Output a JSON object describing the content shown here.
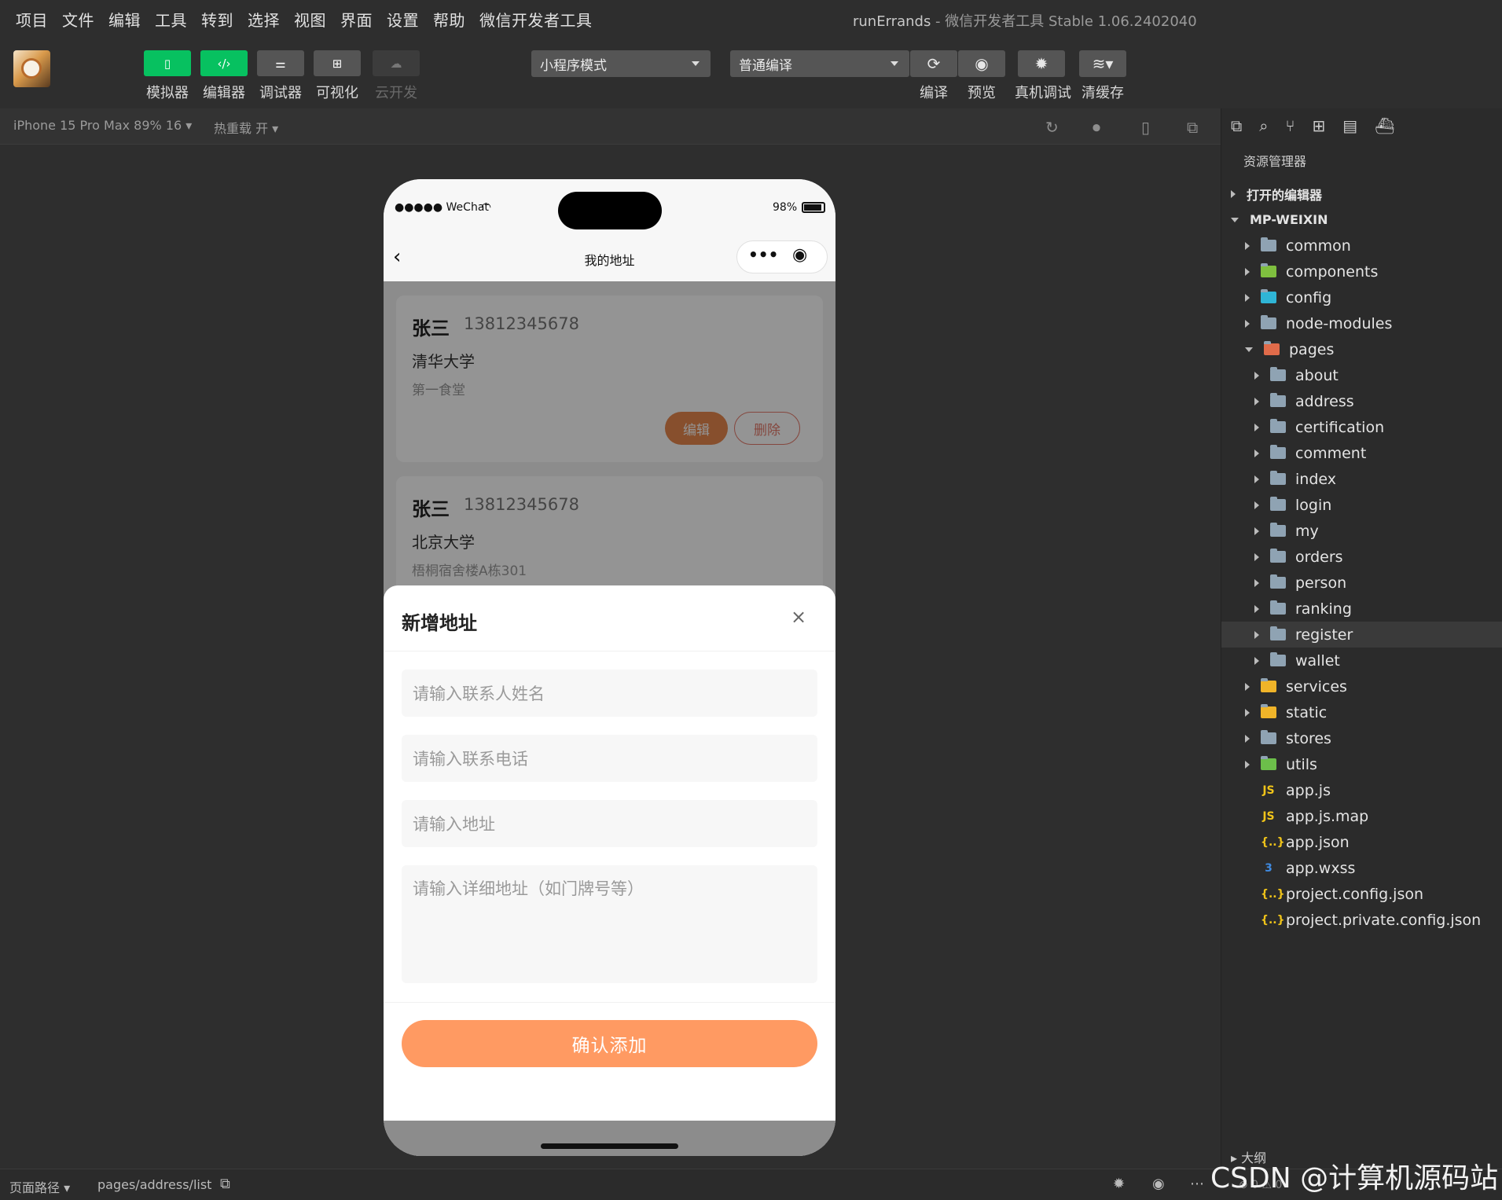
{
  "menubar": {
    "items": [
      "项目",
      "文件",
      "编辑",
      "工具",
      "转到",
      "选择",
      "视图",
      "界面",
      "设置",
      "帮助",
      "微信开发者工具"
    ],
    "title_project": "runErrands",
    "title_rest": " - 微信开发者工具 Stable 1.06.2402040"
  },
  "toolbar": {
    "simulator": "模拟器",
    "editor": "编辑器",
    "debugger": "调试器",
    "visual": "可视化",
    "cloud": "云开发",
    "mode_select": "小程序模式",
    "compile_select": "普通编译",
    "compile": "编译",
    "preview": "预览",
    "real_debug": "真机调试",
    "clear_cache": "清缓存"
  },
  "subbar": {
    "device": "iPhone 15 Pro Max 89% 16 ▾",
    "hot_reload": "热重载 开 ▾"
  },
  "phone": {
    "signal": "●●●●● WeChat",
    "battery": "98%",
    "nav_title": "我的地址",
    "cards": [
      {
        "name": "张三",
        "phone": "13812345678",
        "school": "清华大学",
        "detail": "第一食堂",
        "edit": "编辑",
        "delete": "删除"
      },
      {
        "name": "张三",
        "phone": "13812345678",
        "school": "北京大学",
        "detail": "梧桐宿舍楼A栋301"
      }
    ],
    "sheet": {
      "title": "新增地址",
      "name_placeholder": "请输入联系人姓名",
      "phone_placeholder": "请输入联系电话",
      "address_placeholder": "请输入地址",
      "detail_placeholder": "请输入详细地址（如门牌号等）",
      "confirm": "确认添加"
    }
  },
  "explorer": {
    "title": "资源管理器",
    "open_editors": "打开的编辑器",
    "root": "MP-WEIXIN",
    "top_folders": [
      "common",
      "components",
      "config",
      "node-modules"
    ],
    "pages_label": "pages",
    "pages": [
      "about",
      "address",
      "certification",
      "comment",
      "index",
      "login",
      "my",
      "orders",
      "person",
      "ranking",
      "register",
      "wallet"
    ],
    "after_folders": [
      "services",
      "static",
      "stores",
      "utils"
    ],
    "files": [
      "app.js",
      "app.js.map",
      "app.json",
      "app.wxss",
      "project.config.json",
      "project.private.config.json"
    ],
    "outline": "大纲"
  },
  "statusline": {
    "page_path_label": "页面路径 ▾",
    "page_path": "pages/address/list",
    "counts": "⊗ 0 ⚠ 0"
  },
  "watermark": "CSDN @计算机源码站",
  "colors": {
    "accent_green": "#07c160",
    "confirm_orange": "#ff9a62",
    "edit_orange": "#e8884f"
  }
}
